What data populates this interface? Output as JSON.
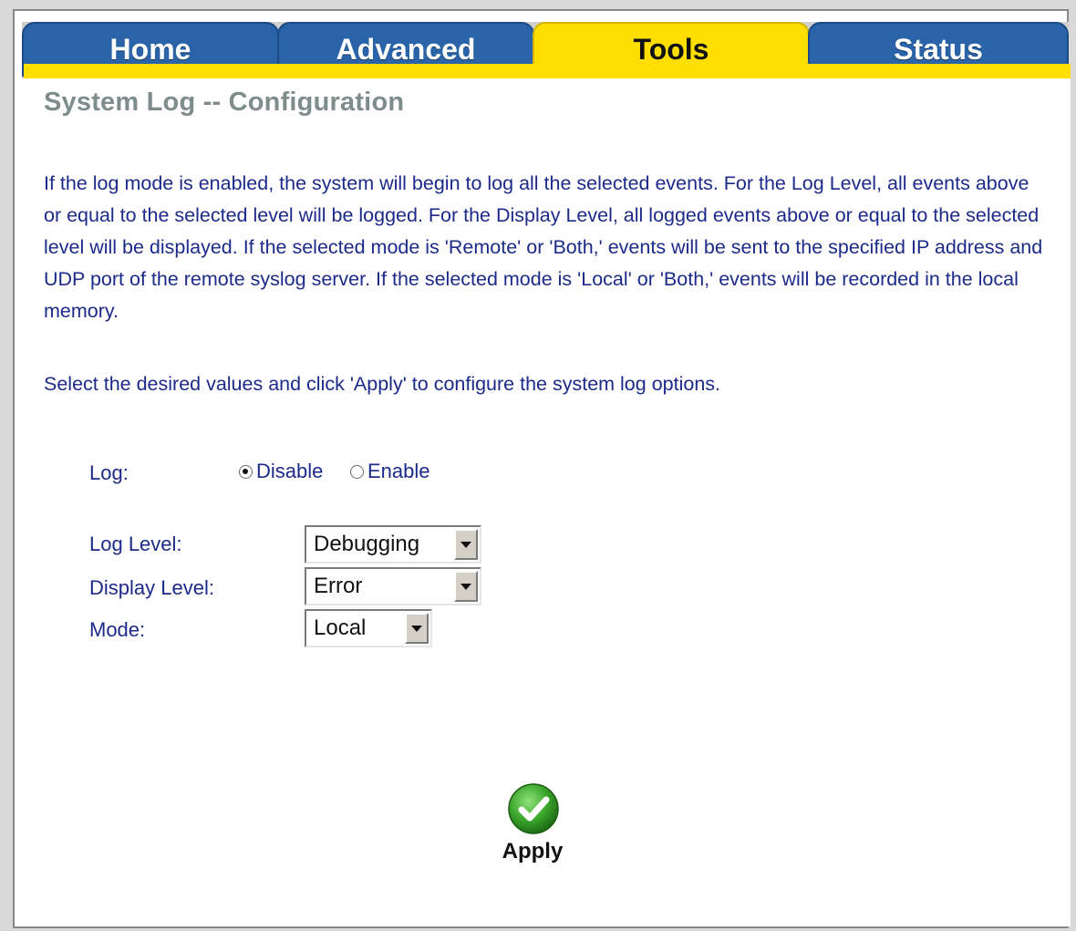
{
  "tabs": [
    {
      "label": "Home",
      "active": false
    },
    {
      "label": "Advanced",
      "active": false
    },
    {
      "label": "Tools",
      "active": true
    },
    {
      "label": "Status",
      "active": false
    }
  ],
  "page": {
    "title": "System Log -- Configuration",
    "description": "If the log mode is enabled, the system will begin to log all the selected events. For the Log Level, all events above or equal to the selected level will be logged. For the Display Level, all logged events above or equal to the selected level will be displayed. If the selected mode is 'Remote' or 'Both,' events will be sent to the specified IP address and UDP port of the remote syslog server. If the selected mode is 'Local' or 'Both,' events will be recorded in the local memory.",
    "instruction": "Select the desired values and click 'Apply' to configure the system log options."
  },
  "form": {
    "log_label": "Log:",
    "log_options": [
      {
        "label": "Disable",
        "checked": true
      },
      {
        "label": "Enable",
        "checked": false
      }
    ],
    "log_level_label": "Log Level:",
    "log_level_value": "Debugging",
    "display_level_label": "Display Level:",
    "display_level_value": "Error",
    "mode_label": "Mode:",
    "mode_value": "Local"
  },
  "apply": {
    "label": "Apply",
    "icon": "check-icon",
    "color": "#3aa52a"
  },
  "colors": {
    "tab_blue": "#2a63a8",
    "tab_active": "#ffde00",
    "text": "#1c2a8a",
    "title": "#7f8c8c"
  }
}
